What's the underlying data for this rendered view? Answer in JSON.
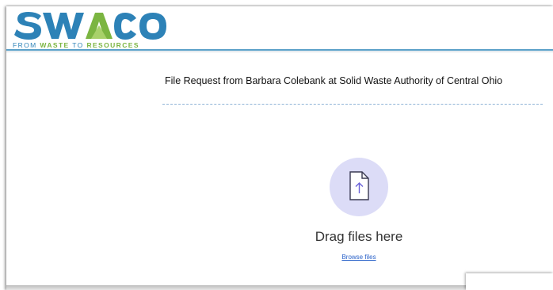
{
  "logo": {
    "wordmark": "SWACO",
    "tagline_from": "FROM ",
    "tagline_strong": "WASTE",
    "tagline_rest": " TO ",
    "tagline_end": "RESOURCES",
    "colors": {
      "blue": "#2d82b7",
      "green": "#7bb541",
      "light_green": "#a8d16a"
    }
  },
  "request": {
    "title": "File Request from Barbara Colebank at Solid Waste Authority of Central Ohio"
  },
  "dropzone": {
    "icon": "file-upload-icon",
    "drag_label": "Drag files here",
    "browse_label": "Browse files"
  },
  "colors": {
    "accent_circle": "#dcdcf7",
    "icon_stroke": "#6b63d9",
    "link": "#2a62c9",
    "header_rule": "#5aa0c8"
  }
}
